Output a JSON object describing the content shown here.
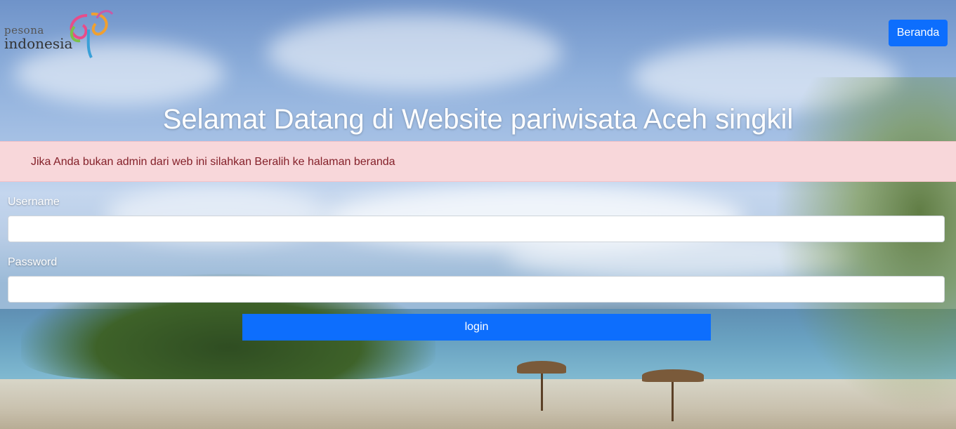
{
  "header": {
    "logo_small": "pesona",
    "logo_big": "indonesia",
    "nav_button": "Beranda"
  },
  "main": {
    "title": "Selamat Datang di Website pariwisata Aceh singkil",
    "alert": "Jika Anda bukan admin dari web ini silahkan Beralih ke halaman beranda"
  },
  "form": {
    "username_label": "Username",
    "username_value": "",
    "password_label": "Password",
    "password_value": "",
    "submit_label": "login"
  },
  "colors": {
    "primary": "#0d6efd",
    "alert_bg": "#f8d7da",
    "alert_text": "#842029"
  }
}
